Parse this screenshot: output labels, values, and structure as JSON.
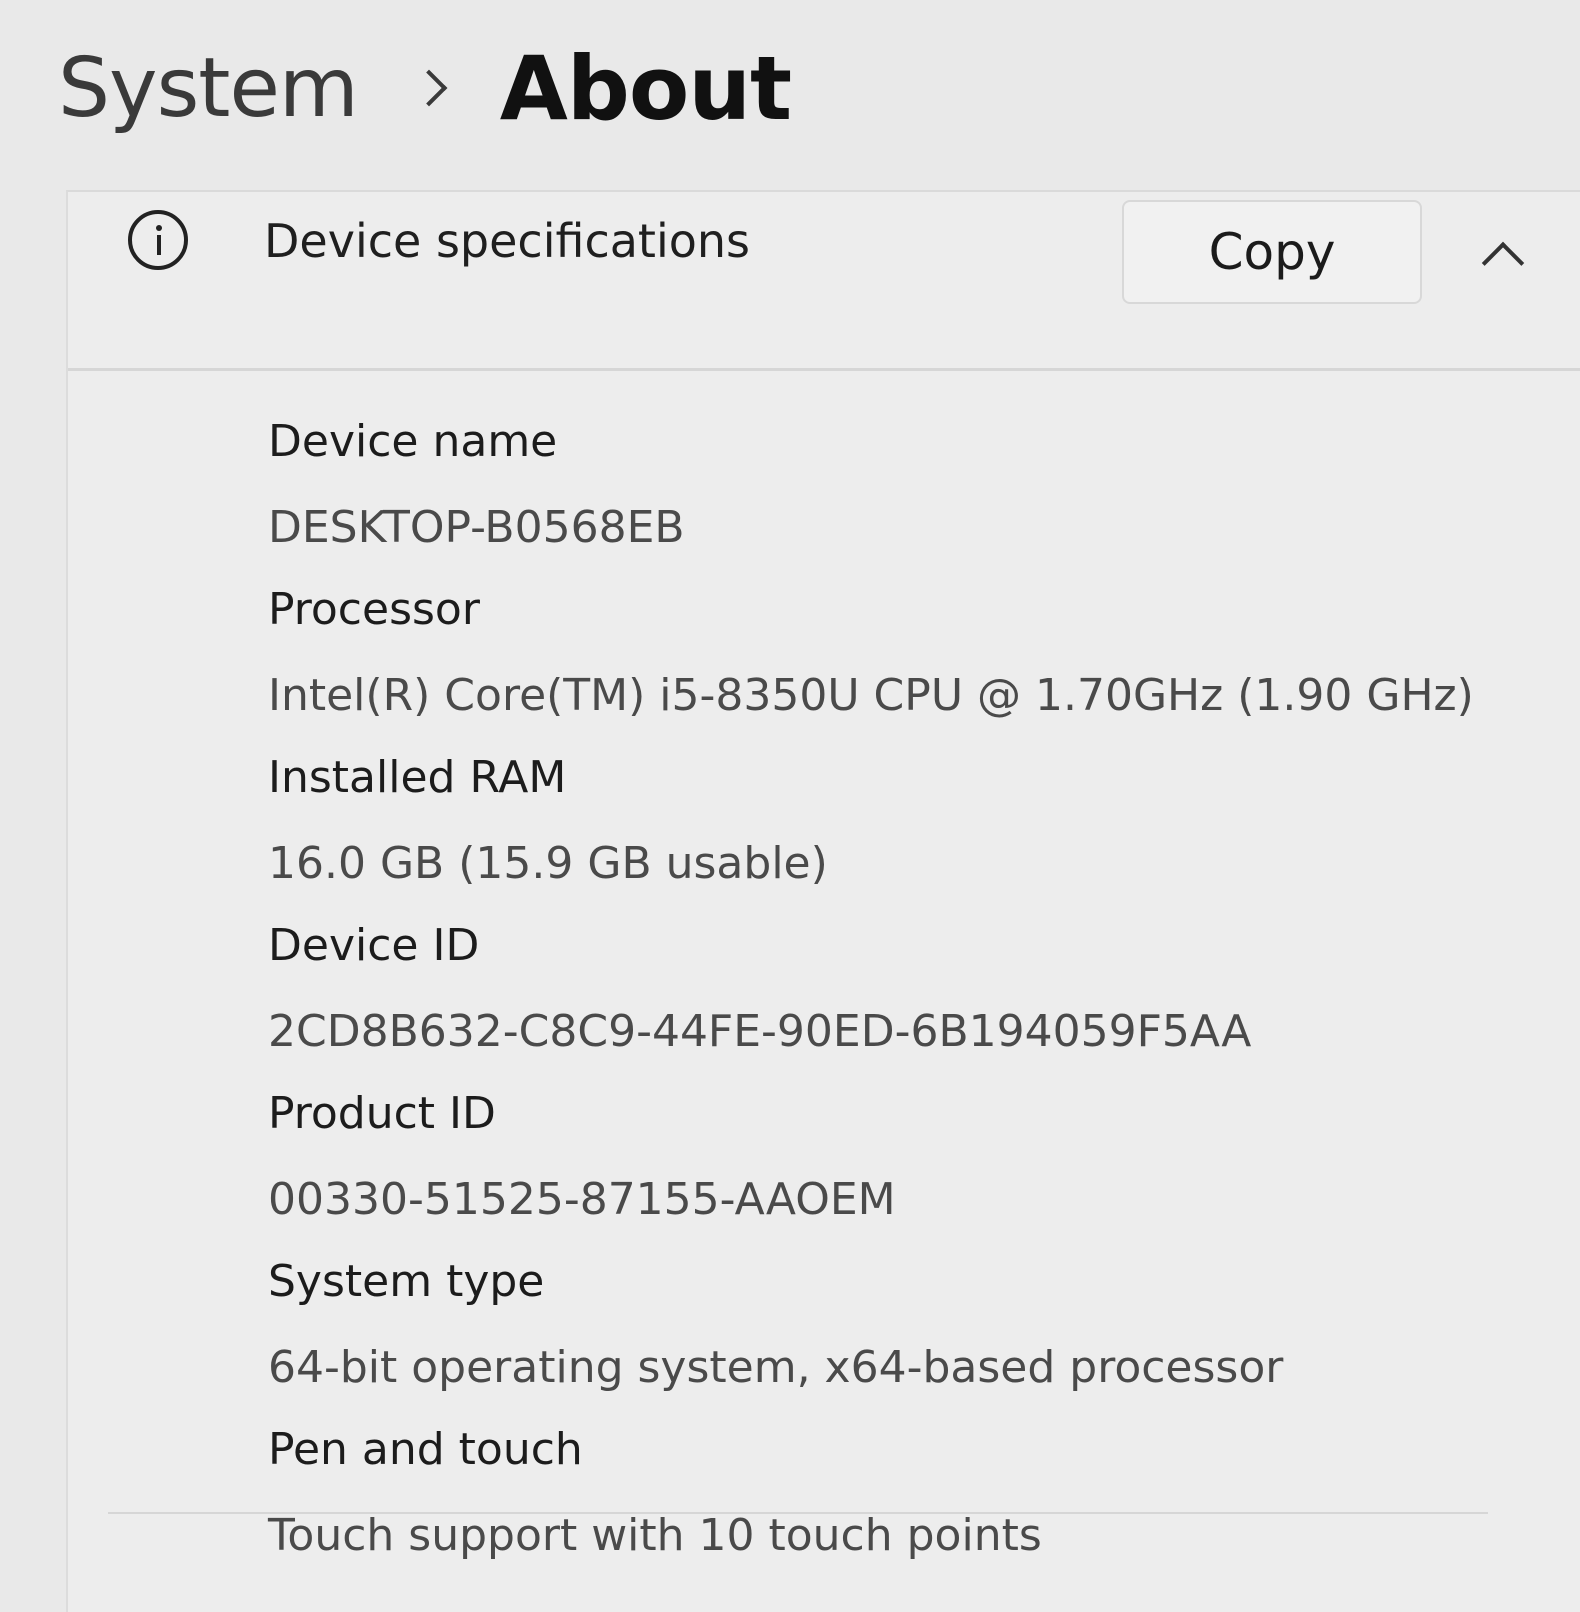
{
  "breadcrumb": {
    "parent": "System",
    "current": "About"
  },
  "device_specifications": {
    "title": "Device specifications",
    "copy_label": "Copy",
    "icon": "info-icon",
    "expand_icon": "chevron-up-icon",
    "items": [
      {
        "label": "Device name",
        "value": "DESKTOP-B0568EB"
      },
      {
        "label": "Processor",
        "value": "Intel(R) Core(TM) i5-8350U CPU @ 1.70GHz (1.90 GHz)"
      },
      {
        "label": "Installed RAM",
        "value": "16.0 GB (15.9 GB usable)"
      },
      {
        "label": "Device ID",
        "value": "2CD8B632-C8C9-44FE-90ED-6B194059F5AA"
      },
      {
        "label": "Product ID",
        "value": "00330-51525-87155-AAOEM"
      },
      {
        "label": "System type",
        "value": "64-bit operating system, x64-based processor"
      },
      {
        "label": "Pen and touch",
        "value": "Touch support with 10 touch points"
      }
    ]
  }
}
